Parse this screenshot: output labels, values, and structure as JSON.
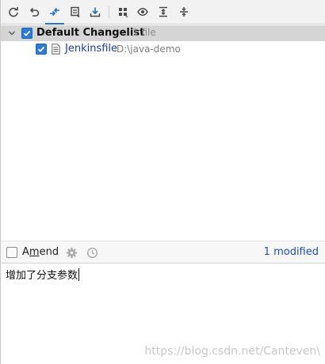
{
  "toolbar": {
    "buttons": [
      {
        "name": "refresh",
        "icon": "refresh-icon"
      },
      {
        "name": "rollback",
        "icon": "rollback-icon"
      },
      {
        "name": "show-diff",
        "icon": "diff-arrows-icon",
        "active": true
      },
      {
        "name": "jump-to-source",
        "icon": "edit-source-icon"
      },
      {
        "name": "update",
        "icon": "download-icon"
      },
      {
        "name": "group-by",
        "icon": "group-by-icon"
      },
      {
        "name": "view-options",
        "icon": "eye-icon"
      },
      {
        "name": "expand-all",
        "icon": "expand-all-icon"
      },
      {
        "name": "collapse-all",
        "icon": "collapse-all-icon"
      }
    ]
  },
  "changes": {
    "changelist": {
      "label": "Default Changelist",
      "count": "1 file",
      "checked": true,
      "expanded": true
    },
    "files": [
      {
        "name": "Jenkinsfile",
        "path": "D:\\java-demo",
        "checked": true
      }
    ]
  },
  "commit_options": {
    "amend_label_pre": "A",
    "amend_label_mnemonic": "m",
    "amend_label_post": "end",
    "amend_checked": false,
    "settings_icon": "gear-icon",
    "history_icon": "clock-icon",
    "status": "1 modified"
  },
  "commit_message": {
    "text": "增加了分支参数"
  },
  "watermark": "https://blog.csdn.net/Canteven\\",
  "colors": {
    "accent": "#2a7ad6",
    "file_link": "#1a3d8f",
    "modified_text": "#1f4fa3",
    "group_row_bg": "#d5d5d5"
  }
}
